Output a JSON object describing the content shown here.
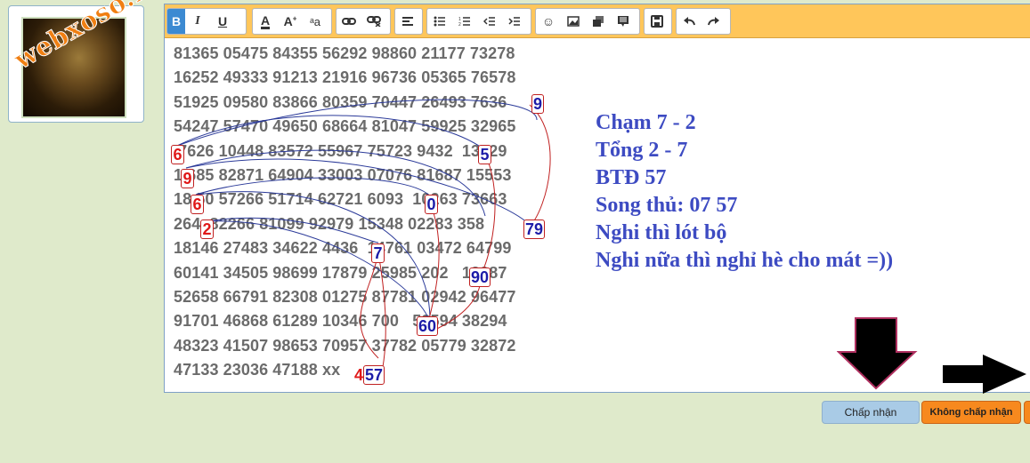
{
  "watermark": "webxoso.net",
  "toolbar": {
    "groups": [
      {
        "name": "format",
        "items": [
          {
            "icon": "bold-icon",
            "glyph": "B"
          },
          {
            "icon": "italic-icon",
            "glyph": "I"
          },
          {
            "icon": "underline-icon",
            "glyph": "U"
          }
        ]
      },
      {
        "name": "font",
        "items": [
          {
            "icon": "font-color-icon",
            "glyph": "A"
          },
          {
            "icon": "font-size-icon",
            "glyph": "Aᶦ"
          },
          {
            "icon": "font-family-icon",
            "glyph": "ᵃa"
          }
        ]
      },
      {
        "name": "link",
        "items": [
          {
            "icon": "link-icon",
            "glyph": "⛓"
          },
          {
            "icon": "unlink-icon",
            "glyph": "⛓"
          }
        ]
      },
      {
        "name": "align",
        "items": [
          {
            "icon": "align-icon",
            "glyph": "≡"
          }
        ]
      },
      {
        "name": "list",
        "items": [
          {
            "icon": "bullet-list-icon",
            "glyph": "☰"
          },
          {
            "icon": "numbered-list-icon",
            "glyph": "☰"
          },
          {
            "icon": "outdent-icon",
            "glyph": "⇤"
          },
          {
            "icon": "indent-icon",
            "glyph": "⇥"
          }
        ]
      },
      {
        "name": "insert",
        "items": [
          {
            "icon": "smiley-icon",
            "glyph": "☺"
          },
          {
            "icon": "image-icon",
            "glyph": "▣"
          },
          {
            "icon": "media-icon",
            "glyph": "▤"
          },
          {
            "icon": "quote-icon",
            "glyph": "▦"
          }
        ]
      },
      {
        "name": "save",
        "items": [
          {
            "icon": "save-icon",
            "glyph": "▭"
          }
        ]
      },
      {
        "name": "history",
        "items": [
          {
            "icon": "undo-icon",
            "glyph": "↶"
          },
          {
            "icon": "redo-icon",
            "glyph": "↷"
          }
        ]
      }
    ]
  },
  "numbers": [
    "81365 05475 84355 56292 98860 21177 73278",
    "16252 49333 91213 21916 96736 05365 76578",
    "51925 09580 83866 80359 70447 26493 7636",
    "54247 57470 49650 68664 81047 59925 32965",
    " 7626 10448 83572 55967 75723 9432  13529",
    "1 685 82871 64904 33003 07076 81687 15553",
    "18 50 57266 51714 62721 6093  10263 73663",
    "264  82266 81099 92979 15348 02283 358",
    "18146 27483 34622 4436  14761 03472 64799",
    "60141 34505 98699 17879 25985 202   13987",
    "52658 66791 82308 01275 87781 02942 96477",
    "91701 46868 61289 10346 700   53594 38294",
    "48323 41507 98653 70957 37782 05779 32872",
    "47133 23036 47188 xx"
  ],
  "highlights": [
    "9",
    "6",
    "5",
    "9",
    "6",
    "0",
    "2",
    "79",
    "7",
    "90",
    "60",
    "4",
    "57"
  ],
  "notes": [
    "Chạm 7 - 2",
    "Tổng 2 - 7",
    "BTĐ 57",
    "Song thủ: 07 57",
    "Nghi thì lót bộ",
    "Nghi nữa thì nghỉ hè cho mát =))"
  ],
  "buttons": {
    "accept": "Chấp nhận",
    "reject": "Không chấp nhận"
  },
  "colors": {
    "toolbar": "#ffc65a",
    "note": "#3d4bc2",
    "highlight_red": "#e01818",
    "highlight_blue": "#1c1ca8",
    "accept_button": "#a9cbe6",
    "reject_button": "#f7891e"
  }
}
